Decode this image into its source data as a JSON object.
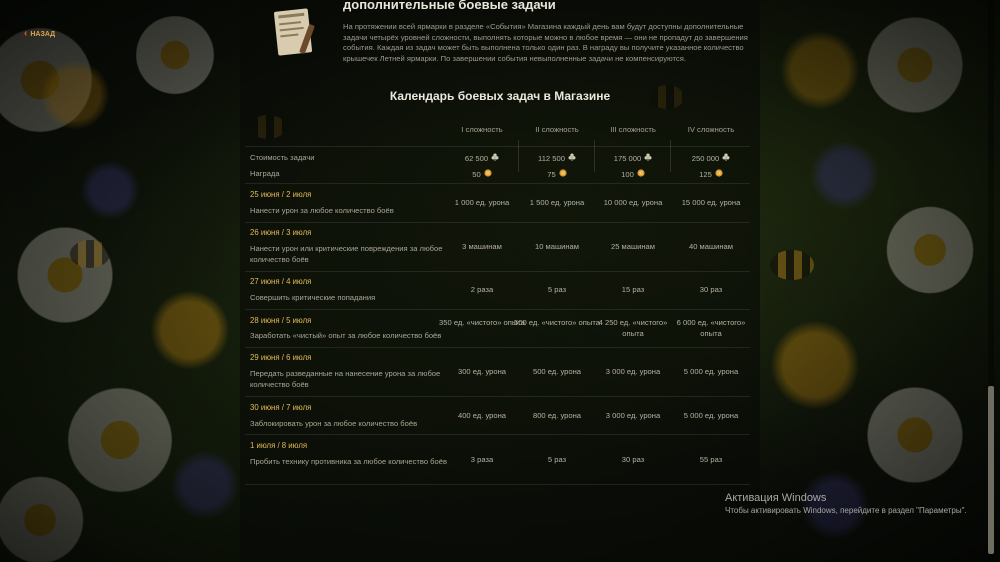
{
  "nav": {
    "back_label": "НАЗАД"
  },
  "header": {
    "title": "дополнительные боевые задачи",
    "intro": "На протяжении всей ярмарки в разделе «События» Магазина каждый день вам будут доступны дополнительные задачи четырёх уровней сложности, выполнять которые можно в любое время — они не пропадут до завершения события. Каждая из задач может быть выполнена только один раз. В награду вы получите указанное количество крышечек Летней ярмарки. По завершении события невыполненные задачи не компенсируются."
  },
  "calendar": {
    "title": "Календарь боевых задач в Магазине",
    "columns": [
      "I сложность",
      "II сложность",
      "III сложность",
      "IV сложность"
    ],
    "cost_label": "Стоимость задачи",
    "reward_label": "Награда",
    "cost": [
      "62 500",
      "112 500",
      "175 000",
      "250 000"
    ],
    "reward": [
      "50",
      "75",
      "100",
      "125"
    ],
    "cost_icon": "clover-icon",
    "reward_icon": "cap-icon",
    "rows": [
      {
        "date": "25 июня / 2 июля",
        "task": "Нанести урон за любое количество боёв",
        "values": [
          "1 000 ед. урона",
          "1 500 ед. урона",
          "10 000 ед. урона",
          "15 000 ед. урона"
        ]
      },
      {
        "date": "26 июня / 3 июля",
        "task": "Нанести урон или критические повреждения за любое количество боёв",
        "values": [
          "3 машинам",
          "10 машинам",
          "25 машинам",
          "40 машинам"
        ]
      },
      {
        "date": "27 июня / 4 июля",
        "task": "Совершить критические попадания",
        "values": [
          "2 раза",
          "5 раз",
          "15 раз",
          "30 раз"
        ]
      },
      {
        "date": "28 июня / 5 июля",
        "task": "Заработать «чистый» опыт за любое количество боёв",
        "values": [
          "350 ед. «чистого» опыта",
          "500 ед. «чистого» опыта",
          "4 250 ед. «чистого» опыта",
          "6 000 ед. «чистого» опыта"
        ]
      },
      {
        "date": "29 июня / 6 июля",
        "task": "Передать разведанные на нанесение урона за любое количество боёв",
        "values": [
          "300 ед. урона",
          "500 ед. урона",
          "3 000 ед. урона",
          "5 000 ед. урона"
        ]
      },
      {
        "date": "30 июня / 7 июля",
        "task": "Заблокировать урон за любое количество боёв",
        "values": [
          "400 ед. урона",
          "800 ед. урона",
          "3 000 ед. урона",
          "5 000 ед. урона"
        ]
      },
      {
        "date": "1 июля / 8 июля",
        "task": "Пробить технику противника за любое количество боёв",
        "values": [
          "3 раза",
          "5 раз",
          "30 раз",
          "55 раз"
        ]
      }
    ]
  },
  "windows_activation": {
    "title": "Активация Windows",
    "subtitle": "Чтобы активировать Windows, перейдите в раздел \"Параметры\"."
  },
  "colors": {
    "accent": "#e4b957",
    "back": "#e7562a",
    "text": "#b4b1a2"
  }
}
